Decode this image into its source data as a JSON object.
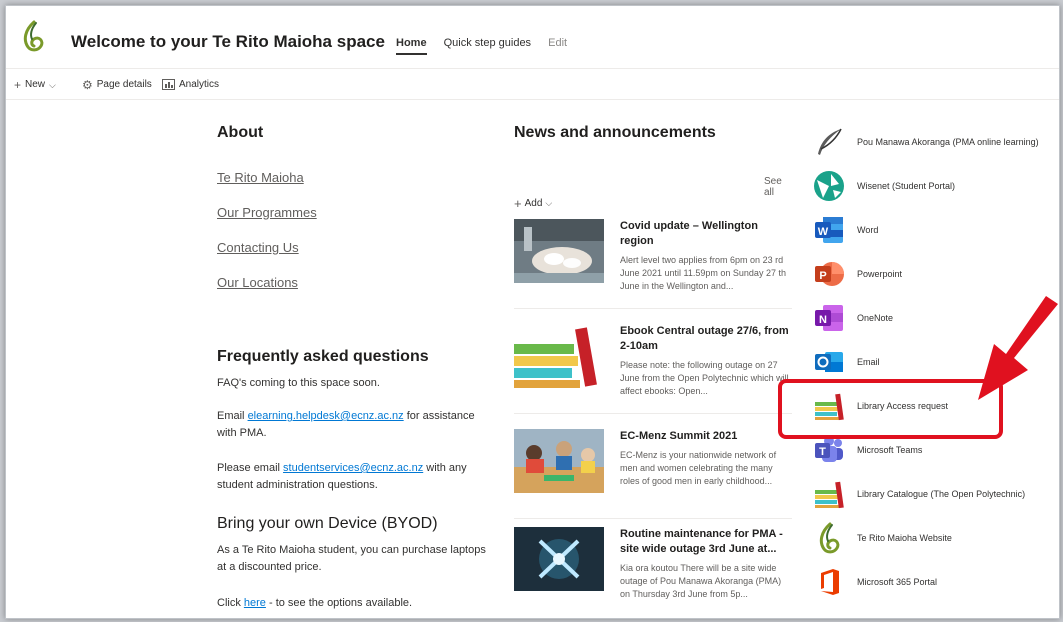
{
  "header": {
    "site_title": "Welcome to your Te Rito Maioha space",
    "nav": {
      "home": "Home",
      "quick_steps": "Quick step guides",
      "edit": "Edit"
    }
  },
  "commandbar": {
    "new": "New",
    "page_details": "Page details",
    "analytics": "Analytics"
  },
  "about": {
    "heading": "About",
    "links": [
      "Te Rito Maioha",
      "Our Programmes",
      "Contacting Us",
      "Our Locations"
    ]
  },
  "faq": {
    "heading": "Frequently asked questions",
    "line1": "FAQ's coming to this space soon.",
    "email_prefix": "Email ",
    "email_link": "elearning.helpdesk@ecnz.ac.nz",
    "email_suffix": " for assistance with PMA.",
    "student_prefix": "Please email ",
    "student_link": "studentservices@ecnz.ac.nz",
    "student_suffix": " with any student administration questions."
  },
  "byod": {
    "heading": "Bring your own Device (BYOD)",
    "text": "As a Te Rito Maioha student, you can purchase laptops at a discounted price.",
    "click_prefix": "Click ",
    "click_link": "here",
    "click_suffix": " - to see the options available."
  },
  "news": {
    "heading": "News and announcements",
    "see_all": "See all",
    "add": "Add",
    "items": [
      {
        "title": "Covid update – Wellington region",
        "desc": "Alert level two applies from 6pm on 23 rd June 2021 until 11.59pm on Sunday 27 th June in the Wellington and..."
      },
      {
        "title": "Ebook Central outage 27/6, from 2-10am",
        "desc": "Please note: the following outage on 27 June from the Open Polytechnic which will affect ebooks: Open..."
      },
      {
        "title": "EC-Menz Summit 2021",
        "desc": "EC-Menz is your nationwide network of men and women celebrating the many roles of good men in early childhood..."
      },
      {
        "title": "Routine maintenance for PMA - site wide outage 3rd June at...",
        "desc": "Kia ora koutou There will be a site wide outage of Pou Manawa Akoranga (PMA) on Thursday 3rd June from 5p..."
      }
    ]
  },
  "quick_links": [
    {
      "label": "Pou Manawa Akoranga (PMA online learning)",
      "icon": "feather-icon"
    },
    {
      "label": "Wisenet (Student Portal)",
      "icon": "wisenet-icon"
    },
    {
      "label": "Word",
      "icon": "word-icon"
    },
    {
      "label": "Powerpoint",
      "icon": "powerpoint-icon"
    },
    {
      "label": "OneNote",
      "icon": "onenote-icon"
    },
    {
      "label": "Email",
      "icon": "outlook-icon"
    },
    {
      "label": "Library Access request",
      "icon": "books-icon"
    },
    {
      "label": "Microsoft Teams",
      "icon": "teams-icon"
    },
    {
      "label": "Library Catalogue (The Open Polytechnic)",
      "icon": "books-icon"
    },
    {
      "label": "Te Rito Maioha Website",
      "icon": "te-rito-logo-icon"
    },
    {
      "label": "Microsoft 365 Portal",
      "icon": "office-icon"
    }
  ],
  "colors": {
    "accent_red": "#e0111f",
    "link_blue": "#0078d4"
  }
}
